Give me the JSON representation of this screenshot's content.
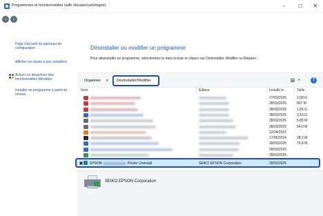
{
  "window": {
    "title": "Programmes et fonctionnalités (with elevated privileges)",
    "controls": {
      "minimize": "–",
      "maximize": "☐",
      "close": "✕"
    }
  },
  "nav": {
    "back": "‹",
    "forward": "›"
  },
  "sidebar": {
    "links": [
      {
        "label": "Page d'accueil du panneau de configuration"
      },
      {
        "label": "Afficher les mises à jour installées"
      },
      {
        "label": "Activer ou désactiver des fonctionnalités Windows",
        "icon": "shield-icon"
      },
      {
        "label": "Installer un programme à partir du réseau"
      }
    ]
  },
  "main": {
    "heading": "Désinstaller ou modifier un programme",
    "subtext": "Pour désinstaller un programme, sélectionnez-le dans la liste et cliquez sur Désinstaller, Modifier ou Réparer."
  },
  "toolbar": {
    "organize_label": "Organiser",
    "organize_caret": "▾",
    "uninstall_label": "Désinstaller/Modifier",
    "view_caret": "▾",
    "help_label": "?"
  },
  "columns": {
    "name": "Nom",
    "publisher": "Éditeur",
    "installed": "Installé le",
    "size": "Taille"
  },
  "rows": [
    {
      "date": "27/03/2025",
      "size": "2,08 G",
      "icon_color": "#d13438"
    },
    {
      "date": "28/03/2025",
      "size": "807 M",
      "icon_color": "#d13438"
    },
    {
      "date": "28/03/2025",
      "size": "1,65 G",
      "icon_color": "#d13438"
    },
    {
      "date": "28/03/2025",
      "size": "3,53 G",
      "icon_color": "#2e6fc2"
    },
    {
      "date": "28/03/2025",
      "size": "5,85 M",
      "icon_color": "#6a6a6a"
    },
    {
      "date": "28/03/2025",
      "size": "54,0 M",
      "icon_color": "#6a6a6a"
    },
    {
      "date": "12/04/2022",
      "size": "",
      "icon_color": "#e07b24"
    },
    {
      "date": "17/05/2024",
      "size": "28,2 M",
      "icon_color": "#2a2a2a"
    },
    {
      "date": "28/03/2025",
      "size": "76,8 M",
      "icon_color": "#2e6fc2"
    },
    {
      "date": "28/03/2025",
      "size": "",
      "icon_color": "#2e6fc2"
    },
    {
      "date": "28/03/2025",
      "size": "",
      "icon_color": "#2e9d4a"
    }
  ],
  "selected": {
    "name": "EPSON",
    "product": "Printer Uninstall",
    "publisher": "SEIKO EPSON Corporation",
    "date": "28/03/2025"
  },
  "details": {
    "publisher": "SEIKO EPSON Corporation"
  },
  "colors": {
    "accent": "#1f47d6",
    "link": "#1e4f8f",
    "heading": "#1e5aa8",
    "selection": "#cde8ff"
  }
}
